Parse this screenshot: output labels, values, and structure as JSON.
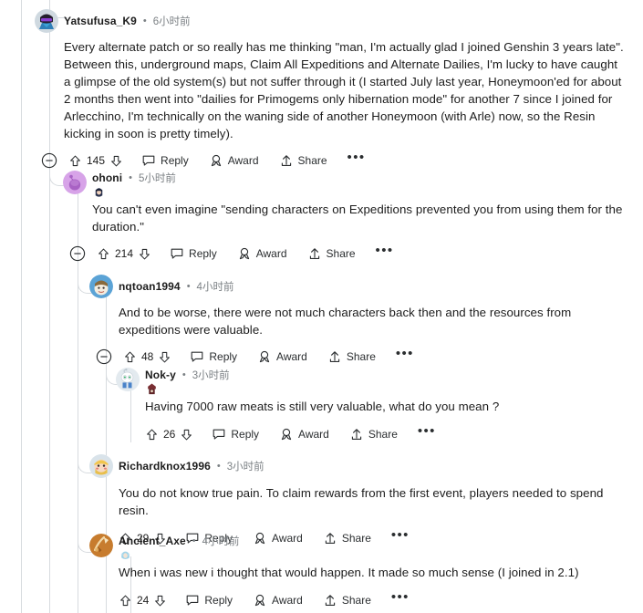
{
  "theme": {
    "bg": "#ffffff",
    "text": "#1c1c1c",
    "meta": "#7b8084",
    "rail": "#d7dbdf"
  },
  "actions": {
    "collapse_icon": "collapse-circle-minus-icon",
    "upvote_icon": "upvote-arrow-icon",
    "downvote_icon": "downvote-arrow-icon",
    "reply_icon": "comment-bubble-icon",
    "reply_label": "Reply",
    "award_icon": "award-medal-icon",
    "award_label": "Award",
    "share_icon": "share-upload-icon",
    "share_label": "Share",
    "more_icon": "more-ellipsis-icon",
    "more_label": "•••"
  },
  "comments": [
    {
      "id": "c1",
      "username": "Yatsufusa_K9",
      "separator": "•",
      "timestamp": "6小时前",
      "avatar_name": "avatar-yatsufusa-k9",
      "avatar_color": "#cfd9e0",
      "has_flair": false,
      "flair_name": "",
      "votes": "145",
      "has_collapse": true,
      "body": "Every alternate patch or so really has me thinking \"man, I'm actually glad I joined Genshin 3 years late\". Between this, underground maps, Claim All Expeditions and Alternate Dailies, I'm lucky to have caught a glimpse of the old system(s) but not suffer through it (I started July last year, Honeymoon'ed for about 2 months then went into \"dailies for Primogems only hibernation mode\" for another 7 since I joined for Arlecchino, I'm technically on the waning side of another Honeymoon (with Arle) now, so the Resin kicking in soon is pretty timely)."
    },
    {
      "id": "c2",
      "username": "ohoni",
      "separator": "•",
      "timestamp": "5小时前",
      "avatar_name": "avatar-ohoni",
      "avatar_color": "#d7a3e8",
      "has_flair": true,
      "flair_name": "flair-character-icon",
      "votes": "214",
      "has_collapse": true,
      "body": "You can't even imagine \"sending characters on Expeditions prevented you from using them for the duration.\""
    },
    {
      "id": "c3",
      "username": "nqtoan1994",
      "separator": "•",
      "timestamp": "4小时前",
      "avatar_name": "avatar-nqtoan1994",
      "avatar_color": "#5ba3d6",
      "has_flair": false,
      "flair_name": "",
      "votes": "48",
      "has_collapse": true,
      "body": "And to be worse, there were not much characters back then and the resources from expeditions were valuable."
    },
    {
      "id": "c4",
      "username": "Nok-y",
      "separator": "•",
      "timestamp": "3小时前",
      "avatar_name": "avatar-nok-y",
      "avatar_color": "#e3eaef",
      "has_flair": true,
      "flair_name": "flair-hilichurl-icon",
      "votes": "26",
      "has_collapse": false,
      "body": "Having 7000 raw meats is still very valuable, what do you mean ?"
    },
    {
      "id": "c5",
      "username": "Richardknox1996",
      "separator": "•",
      "timestamp": "3小时前",
      "avatar_name": "avatar-richardknox1996",
      "avatar_color": "#d9e3ea",
      "has_flair": false,
      "flair_name": "",
      "votes": "29",
      "has_collapse": false,
      "body": "You do not know true pain. To claim rewards from the first event, players needed to spend resin."
    },
    {
      "id": "c6",
      "username": "Ancient_Axe",
      "separator": "•",
      "timestamp": "4小时前",
      "avatar_name": "avatar-ancient-axe",
      "avatar_color": "#c77c2e",
      "has_flair": true,
      "flair_name": "flair-character-blue-icon",
      "votes": "24",
      "has_collapse": false,
      "body": "When i was new i thought that would happen. It made so much sense (I joined in 2.1)"
    }
  ]
}
